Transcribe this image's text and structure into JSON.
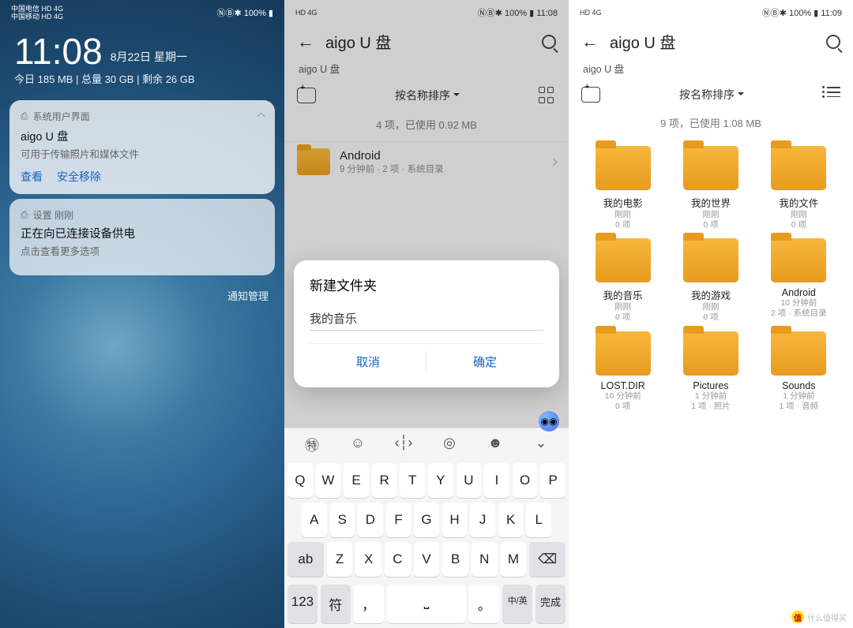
{
  "panel1": {
    "status": {
      "carrier1": "中国电信 HD 4G",
      "carrier2": "中国移动 HD 4G",
      "icons_right": "ⓃⒷ✱ 100% ▮"
    },
    "clock": {
      "time": "11:08",
      "date": "8月22日 星期一"
    },
    "storage": "今日 185 MB | 总量 30 GB | 剩余 26 GB",
    "notif1": {
      "source": "系统用户界面",
      "title": "aigo U 盘",
      "subtitle": "可用于传输照片和媒体文件",
      "action_view": "查看",
      "action_eject": "安全移除"
    },
    "notif2": {
      "source": "设置  刚刚",
      "title": "正在向已连接设备供电",
      "subtitle": "点击查看更多选项"
    },
    "manage": "通知管理"
  },
  "panel2": {
    "status_left": "HD 4G",
    "status_right": "ⓃⒷ✱ 100% ▮ 11:08",
    "title": "aigo U 盘",
    "breadcrumb": "aigo U 盘",
    "sort_label": "按名称排序",
    "usage": "4 项，已使用 0.92 MB",
    "folder": {
      "name": "Android",
      "info": "9 分钟前 · 2 项 · 系统目录"
    },
    "dialog": {
      "title": "新建文件夹",
      "input": "我的音乐",
      "cancel": "取消",
      "ok": "确定"
    },
    "keyboard": {
      "tool_icons": [
        "㊕",
        "☺",
        "‹┆›",
        "◎",
        "☻",
        "⌄"
      ],
      "row1": [
        "Q",
        "W",
        "E",
        "R",
        "T",
        "Y",
        "U",
        "I",
        "O",
        "P"
      ],
      "row2": [
        "A",
        "S",
        "D",
        "F",
        "G",
        "H",
        "J",
        "K",
        "L"
      ],
      "row3_shift": "ab",
      "row3": [
        "Z",
        "X",
        "C",
        "V",
        "B",
        "N",
        "M"
      ],
      "row3_del": "⌫",
      "bottom": {
        "num": "123",
        "sym": "符",
        "comma": "，",
        "space": "⎵",
        "period": "。",
        "lang": "中/英",
        "enter": "完成"
      }
    }
  },
  "panel3": {
    "status_left": "HD 4G",
    "status_right": "ⓃⒷ✱ 100% ▮ 11:09",
    "title": "aigo U 盘",
    "breadcrumb": "aigo U 盘",
    "sort_label": "按名称排序",
    "usage": "9 项，已使用 1.08 MB",
    "folders": [
      {
        "name": "我的电影",
        "t": "刚刚",
        "c": "0 项"
      },
      {
        "name": "我的世界",
        "t": "刚刚",
        "c": "0 项"
      },
      {
        "name": "我的文件",
        "t": "刚刚",
        "c": "0 项"
      },
      {
        "name": "我的音乐",
        "t": "刚刚",
        "c": "0 项"
      },
      {
        "name": "我的游戏",
        "t": "刚刚",
        "c": "0 项"
      },
      {
        "name": "Android",
        "t": "10 分钟前",
        "c": "2 项 · 系统目录"
      },
      {
        "name": "LOST.DIR",
        "t": "10 分钟前",
        "c": "0 项"
      },
      {
        "name": "Pictures",
        "t": "1 分钟前",
        "c": "1 项 · 照片"
      },
      {
        "name": "Sounds",
        "t": "1 分钟前",
        "c": "1 项 · 音频"
      }
    ]
  },
  "watermark": {
    "icon": "值",
    "text": "什么值得买"
  }
}
